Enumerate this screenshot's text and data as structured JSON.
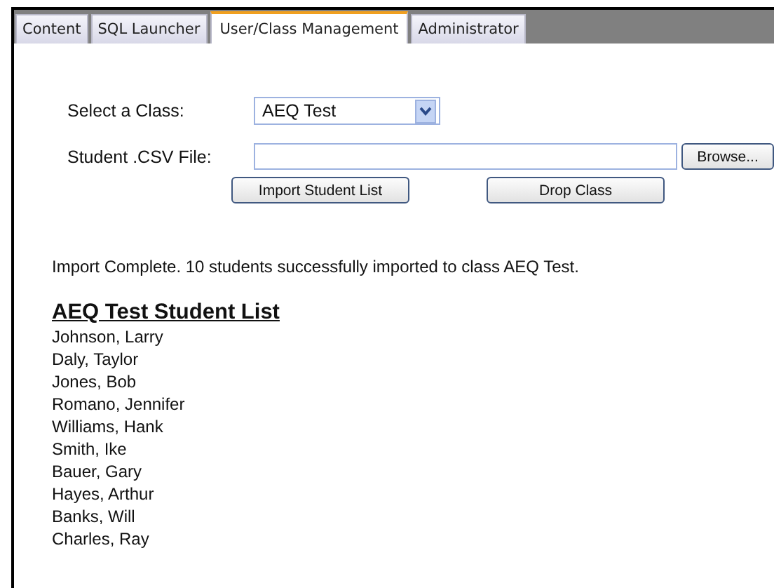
{
  "tabs": [
    {
      "label": "Content",
      "selected": false
    },
    {
      "label": "SQL Launcher",
      "selected": false
    },
    {
      "label": "User/Class Management",
      "selected": true
    },
    {
      "label": "Administrator",
      "selected": false
    }
  ],
  "class_select": {
    "label": "Select a Class:",
    "value": "AEQ Test"
  },
  "csv_file": {
    "label": "Student .CSV File:",
    "browse_button": "Browse..."
  },
  "buttons": [
    "Import Student List",
    "Drop Class"
  ],
  "message": "Import Complete. 10 students successfully imported to class AEQ Test.",
  "list_title": "AEQ Test Student List",
  "students": [
    "Johnson, Larry",
    "Daly, Taylor",
    "Jones, Bob",
    "Romano, Jennifer",
    "Williams, Hank",
    "Smith, Ike",
    "Bauer, Gary",
    "Hayes, Arthur",
    "Banks, Will",
    "Charles, Ray"
  ]
}
